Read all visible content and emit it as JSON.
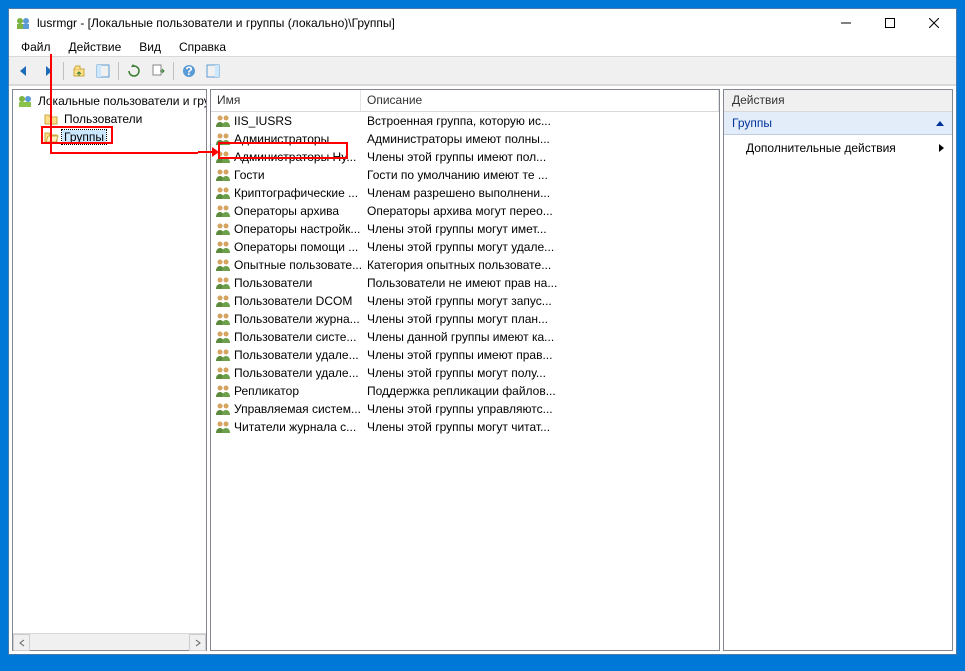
{
  "title": "lusrmgr - [Локальные пользователи и группы (локально)\\Группы]",
  "menu": {
    "file": "Файл",
    "action": "Действие",
    "view": "Вид",
    "help": "Справка"
  },
  "tree": {
    "root": "Локальные пользователи и гру",
    "users": "Пользователи",
    "groups": "Группы"
  },
  "columns": {
    "name": "Имя",
    "desc": "Описание"
  },
  "groups": [
    {
      "name": "IIS_IUSRS",
      "desc": "Встроенная группа, которую ис..."
    },
    {
      "name": "Администраторы",
      "desc": "Администраторы имеют полны..."
    },
    {
      "name": "Администраторы Hy...",
      "desc": "Члены этой группы имеют пол..."
    },
    {
      "name": "Гости",
      "desc": "Гости по умолчанию имеют те ..."
    },
    {
      "name": "Криптографические ...",
      "desc": "Членам разрешено выполнени..."
    },
    {
      "name": "Операторы архива",
      "desc": "Операторы архива могут перео..."
    },
    {
      "name": "Операторы настройк...",
      "desc": "Члены этой группы могут имет..."
    },
    {
      "name": "Операторы помощи ...",
      "desc": "Члены этой группы могут удале..."
    },
    {
      "name": "Опытные пользовате...",
      "desc": "Категория опытных пользовате..."
    },
    {
      "name": "Пользователи",
      "desc": "Пользователи не имеют прав на..."
    },
    {
      "name": "Пользователи DCOM",
      "desc": "Члены этой группы могут запус..."
    },
    {
      "name": "Пользователи журна...",
      "desc": "Члены этой группы могут план..."
    },
    {
      "name": "Пользователи систе...",
      "desc": "Члены данной группы имеют ка..."
    },
    {
      "name": "Пользователи удале...",
      "desc": "Члены этой группы имеют прав..."
    },
    {
      "name": "Пользователи удале...",
      "desc": "Члены этой группы могут полу..."
    },
    {
      "name": "Репликатор",
      "desc": "Поддержка репликации файлов..."
    },
    {
      "name": "Управляемая систем...",
      "desc": "Члены этой группы управляютс..."
    },
    {
      "name": "Читатели журнала с...",
      "desc": "Члены этой группы могут читат..."
    }
  ],
  "actions": {
    "header": "Действия",
    "section": "Группы",
    "more": "Дополнительные действия"
  }
}
